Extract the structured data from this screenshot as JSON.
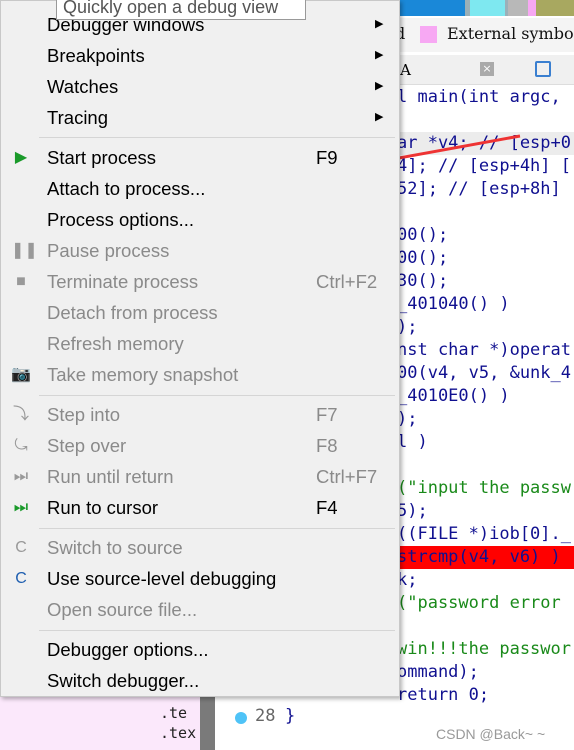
{
  "tooltip": "Quickly open a debug view",
  "menu": {
    "items": [
      {
        "label": "Debugger windows",
        "submenu": true,
        "enabled": true
      },
      {
        "label": "Breakpoints",
        "submenu": true,
        "enabled": true
      },
      {
        "label": "Watches",
        "submenu": true,
        "enabled": true
      },
      {
        "label": "Tracing",
        "submenu": true,
        "enabled": true
      },
      {
        "label": "Start process",
        "shortcut": "F9",
        "icon": "play-icon",
        "enabled": true
      },
      {
        "label": "Attach to process...",
        "enabled": true
      },
      {
        "label": "Process options...",
        "enabled": true
      },
      {
        "label": "Pause process",
        "icon": "pause-icon",
        "enabled": false
      },
      {
        "label": "Terminate process",
        "shortcut": "Ctrl+F2",
        "icon": "stop-icon",
        "enabled": false
      },
      {
        "label": "Detach from process",
        "enabled": false
      },
      {
        "label": "Refresh memory",
        "enabled": false
      },
      {
        "label": "Take memory snapshot",
        "icon": "camera-icon",
        "enabled": false
      },
      {
        "label": "Step into",
        "shortcut": "F7",
        "icon": "step-into-icon",
        "enabled": false
      },
      {
        "label": "Step over",
        "shortcut": "F8",
        "icon": "step-over-icon",
        "enabled": false
      },
      {
        "label": "Run until return",
        "shortcut": "Ctrl+F7",
        "icon": "run-until-return-icon",
        "enabled": false
      },
      {
        "label": "Run to cursor",
        "shortcut": "F4",
        "icon": "run-to-cursor-icon",
        "enabled": true
      },
      {
        "label": "Switch to source",
        "icon": "switch-source-icon",
        "enabled": false
      },
      {
        "label": "Use source-level debugging",
        "icon": "source-debug-icon",
        "enabled": true
      },
      {
        "label": "Open source file...",
        "enabled": false
      },
      {
        "label": "Debugger options...",
        "enabled": true
      },
      {
        "label": "Switch debugger...",
        "enabled": true
      }
    ]
  },
  "legend": {
    "prefix": "d",
    "label": "External symbo"
  },
  "tab": {
    "label": "-A"
  },
  "code_lines": [
    "l main(int argc,",
    "",
    "ar *v4; // [esp+0",
    "4]; // [esp+4h] [",
    "52]; // [esp+8h] [",
    "",
    "00();",
    "00();",
    "30();",
    "_401040() )",
    ");",
    "nst char *)operat",
    "00(v4, v5, &unk_4",
    "_4010E0() )",
    ");",
    "l )",
    "",
    "(\"input the passw",
    "5);",
    "((FILE *)iob[0]._",
    "strcmp(v4, v6) )",
    "k;",
    "(\"password error",
    "",
    "win!!!the passwor",
    "ommand);",
    "return 0;"
  ],
  "last_line": {
    "number": "28",
    "text": "}"
  },
  "segments": [
    ".te",
    ".tex"
  ],
  "watermark": "CSDN @Back~ ~",
  "colors": {
    "accent_arrow": "#ee3333",
    "breakpoint_line": "#ff0000",
    "highlight": "#ffff00"
  }
}
